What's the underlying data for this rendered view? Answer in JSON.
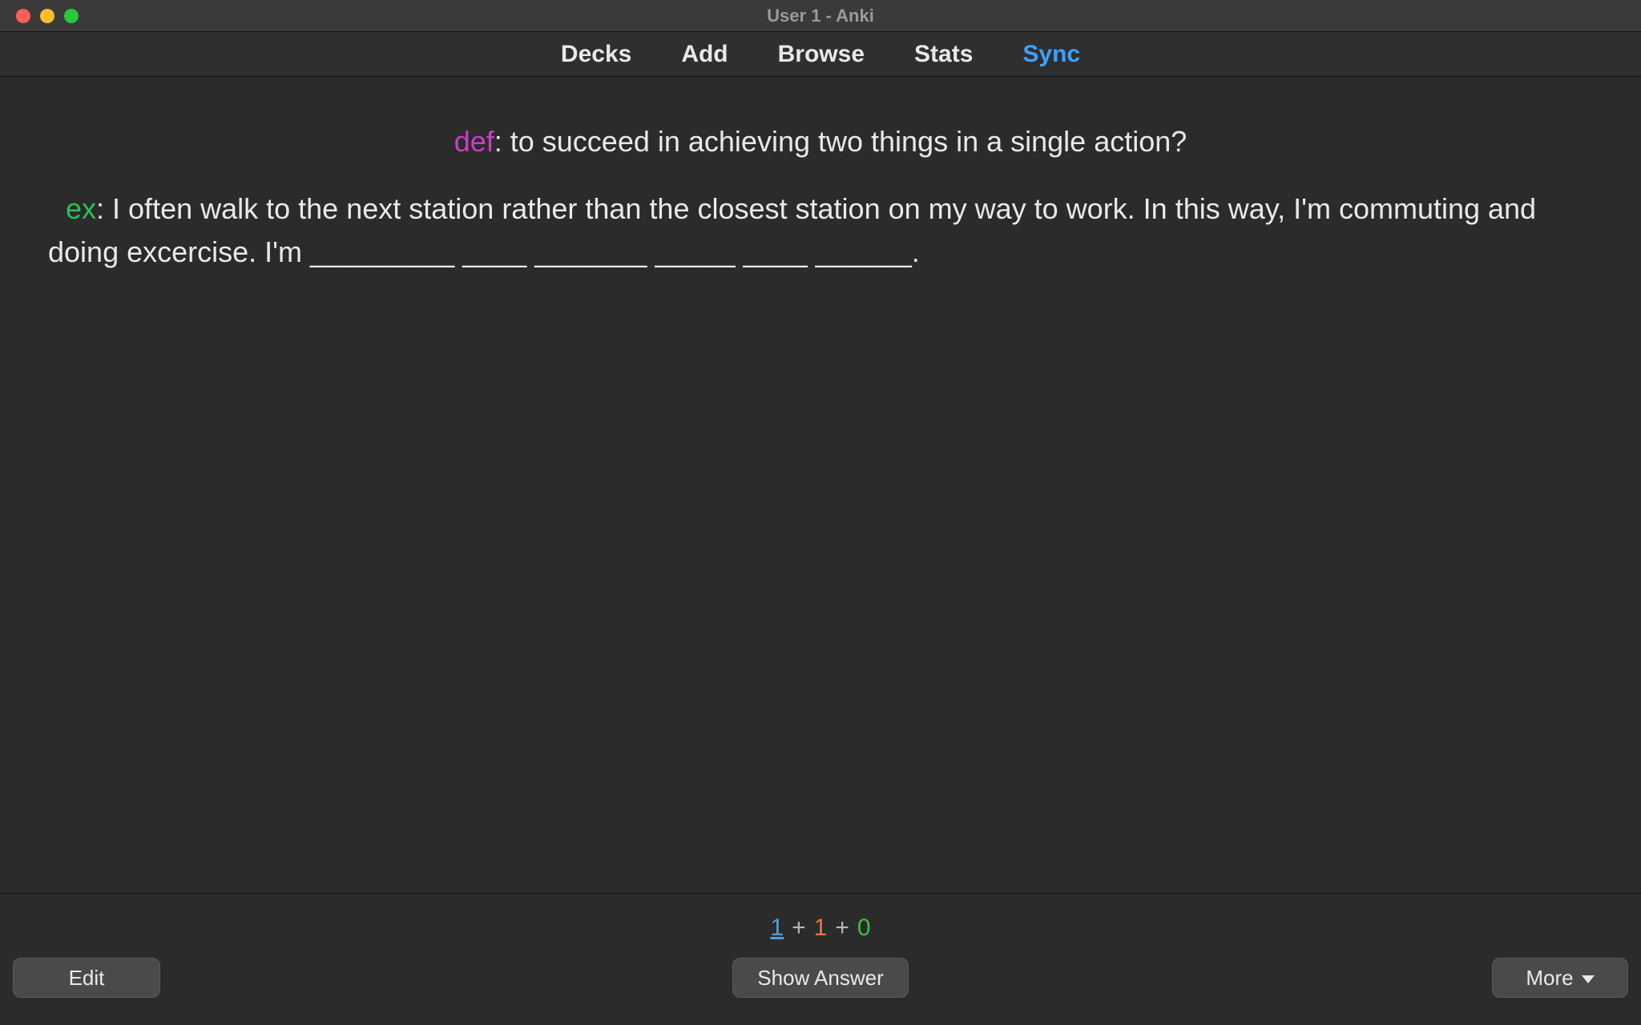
{
  "window": {
    "title": "User 1 - Anki"
  },
  "nav": {
    "decks": "Decks",
    "add": "Add",
    "browse": "Browse",
    "stats": "Stats",
    "sync": "Sync"
  },
  "card": {
    "def_label": "def",
    "def_text": ": to succeed in achieving two things in a single action?",
    "ex_label": "ex",
    "ex_text": ": I often walk to the next station rather than the closest station on my way to work. In this way, I'm commuting and doing excercise. I'm _________ ____ _______ _____ ____ ______."
  },
  "counts": {
    "new": "1",
    "learn": "1",
    "review": "0"
  },
  "buttons": {
    "edit": "Edit",
    "show_answer": "Show Answer",
    "more": "More"
  }
}
